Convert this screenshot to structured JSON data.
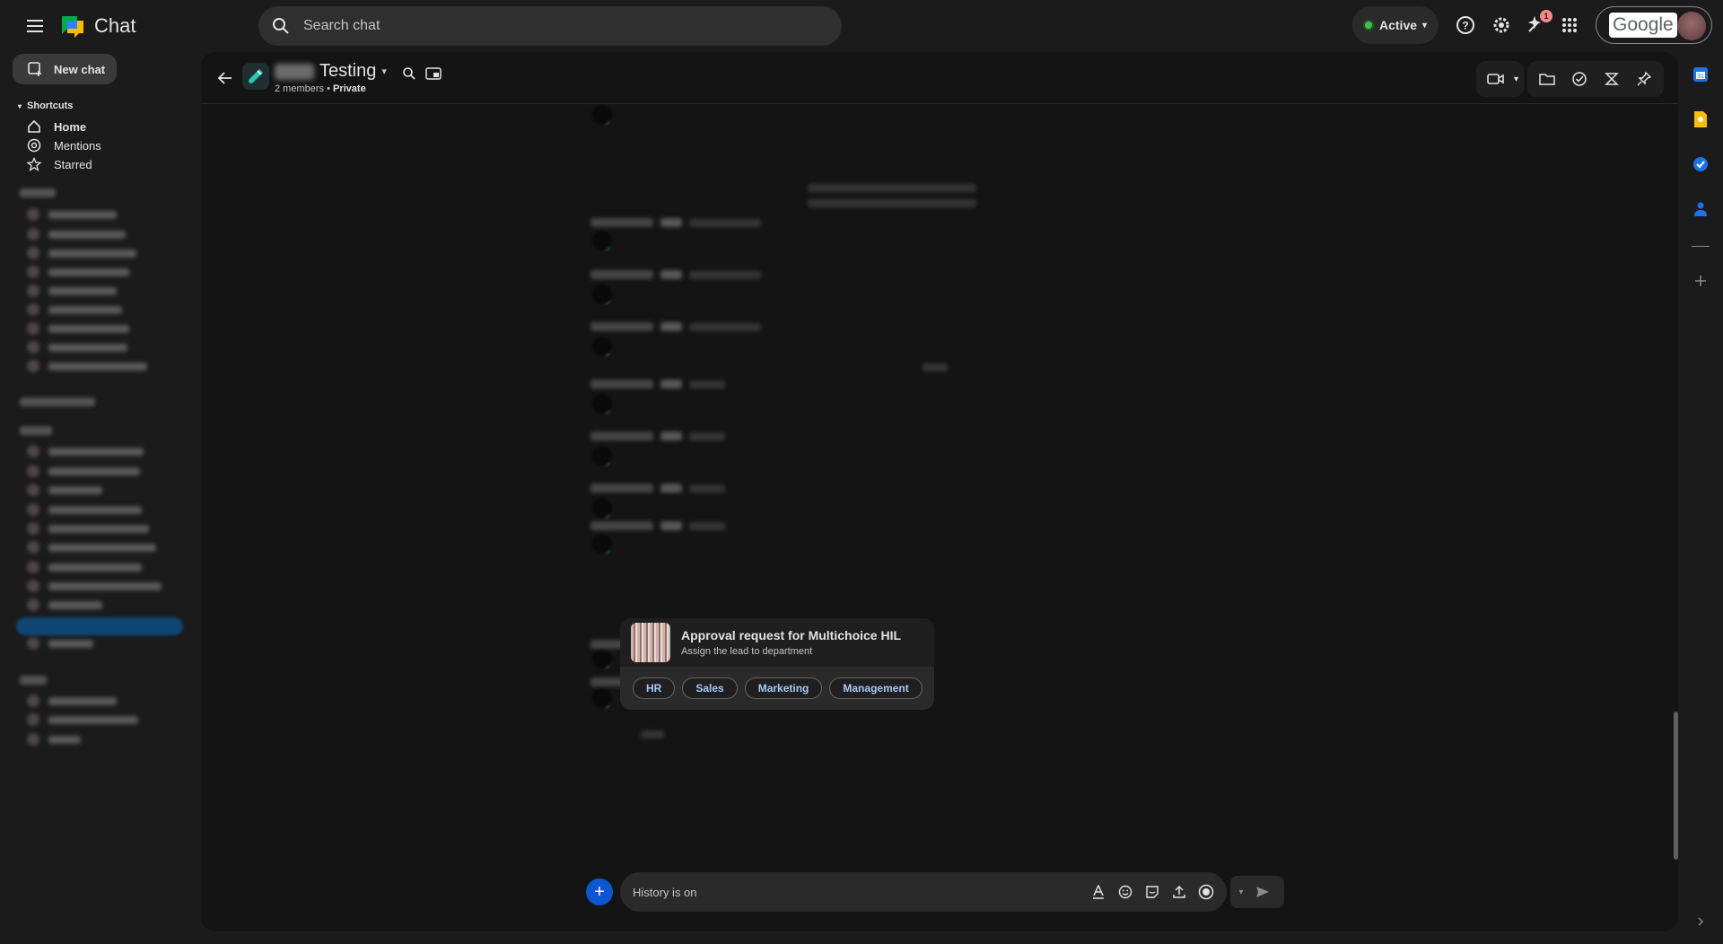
{
  "app": {
    "name": "Chat"
  },
  "search": {
    "placeholder": "Search chat"
  },
  "status": {
    "label": "Active",
    "color": "#3fbf4f"
  },
  "notifications": {
    "count": "1"
  },
  "account": {
    "logo_text": "Google"
  },
  "sidebar": {
    "new_chat_label": "New chat",
    "shortcuts_label": "Shortcuts",
    "items": [
      {
        "label": "Home",
        "icon": "home-icon",
        "bold": true
      },
      {
        "label": "Mentions",
        "icon": "at-icon"
      },
      {
        "label": "Starred",
        "icon": "star-icon"
      }
    ]
  },
  "space": {
    "name": "Testing",
    "members": "2 members",
    "privacy": "Private",
    "icon": "test-tube-icon"
  },
  "card": {
    "title": "Approval request for Multichoice HIL",
    "subtitle": "Assign the lead to department",
    "buttons": [
      "HR",
      "Sales",
      "Marketing",
      "Management"
    ],
    "chip_color": "#a8c7fa"
  },
  "composer": {
    "placeholder": "History is on"
  },
  "colors": {
    "accent": "#0b57d0",
    "background": "#1b1b1b",
    "panel": "#141414"
  }
}
